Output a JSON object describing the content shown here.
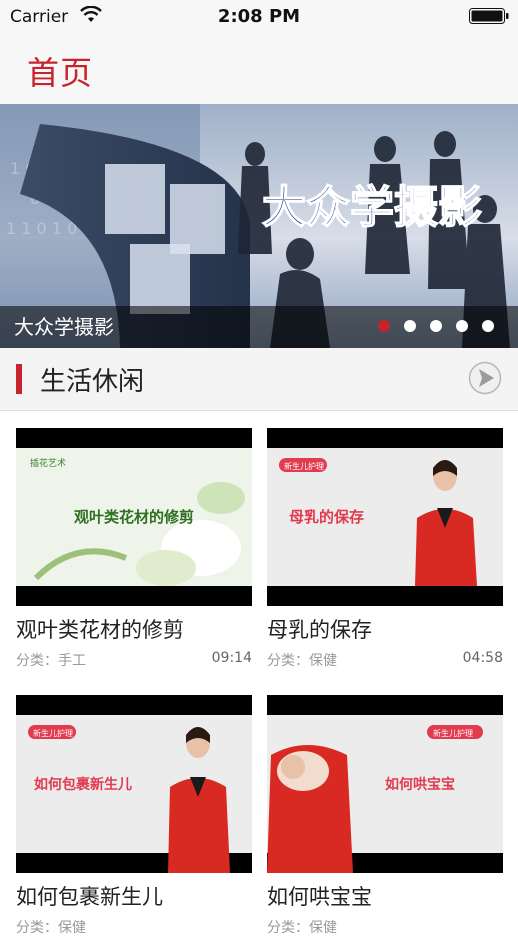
{
  "status_bar": {
    "carrier": "Carrier",
    "time": "2:08 PM"
  },
  "nav": {
    "title": "首页"
  },
  "banner": {
    "image_text": "大众学摄影",
    "caption": "大众学摄影",
    "page_count": 5,
    "active_page": 1
  },
  "section": {
    "title": "生活休闲"
  },
  "videos": [
    {
      "title": "观叶类花材的修剪",
      "category": "分类：手工",
      "duration": "09:14",
      "thumb_text": "观叶类花材的修剪",
      "thumb_logo": "插花艺术"
    },
    {
      "title": "母乳的保存",
      "category": "分类：保健",
      "duration": "04:58",
      "thumb_text": "母乳的保存",
      "thumb_logo": "新生儿护理"
    },
    {
      "title": "如何包裹新生儿",
      "category": "分类：保健",
      "duration": "",
      "thumb_text": "如何包裹新生儿",
      "thumb_logo": "新生儿护理"
    },
    {
      "title": "如何哄宝宝",
      "category": "分类：保健",
      "duration": "",
      "thumb_text": "如何哄宝宝",
      "thumb_logo": "新生儿护理"
    }
  ],
  "colors": {
    "accent": "#c8232c",
    "section_bg": "#f4f4f4"
  }
}
